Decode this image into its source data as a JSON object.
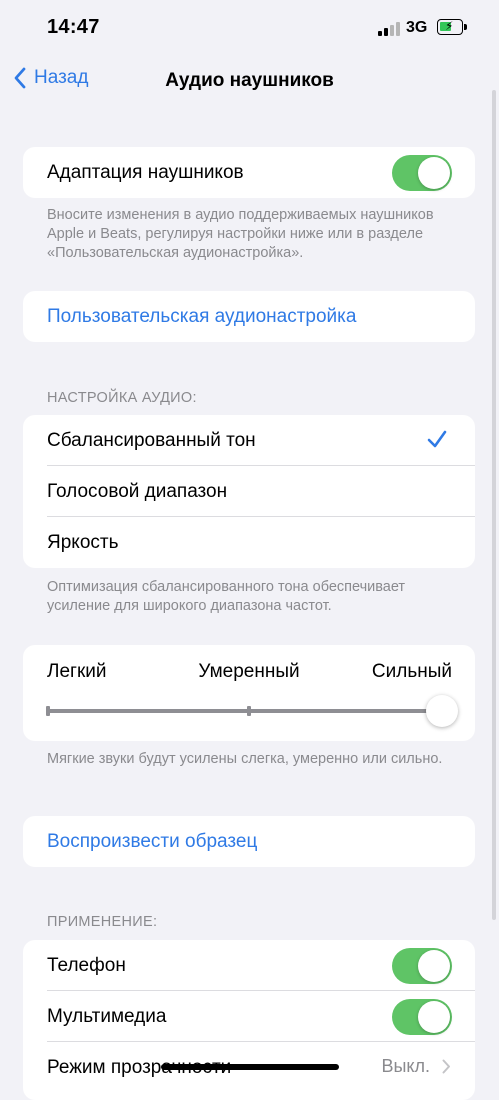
{
  "status": {
    "time": "14:47",
    "network": "3G"
  },
  "nav": {
    "back_label": "Назад",
    "title": "Аудио наушников"
  },
  "adaptation": {
    "label": "Адаптация наушников",
    "enabled": true,
    "footer": "Вносите изменения в аудио поддерживаемых наушников Apple и Beats, регулируя настройки ниже или в разделе «Пользовательская аудионастройка»."
  },
  "custom_setup": {
    "label": "Пользовательская аудионастройка"
  },
  "audio_tune": {
    "header": "НАСТРОЙКА АУДИО:",
    "options": [
      {
        "label": "Сбалансированный тон",
        "selected": true
      },
      {
        "label": "Голосовой диапазон",
        "selected": false
      },
      {
        "label": "Яркость",
        "selected": false
      }
    ],
    "footer": "Оптимизация сбалансированного тона обеспечивает усиление для широкого диапазона частот."
  },
  "strength": {
    "labels": {
      "low": "Легкий",
      "mid": "Умеренный",
      "high": "Сильный"
    },
    "level": 1.0,
    "footer": "Мягкие звуки будут усилены слегка, умеренно или сильно."
  },
  "sample": {
    "label": "Воспроизвести образец"
  },
  "apply": {
    "header": "ПРИМЕНЕНИЕ:",
    "items": [
      {
        "label": "Телефон",
        "enabled": true
      },
      {
        "label": "Мультимедиа",
        "enabled": true
      },
      {
        "label": "Режим прозрачности",
        "value": "Выкл."
      }
    ]
  },
  "colors": {
    "accent": "#2f7ae5",
    "toggle_on": "#5fc466",
    "background": "#f2f2f7"
  }
}
